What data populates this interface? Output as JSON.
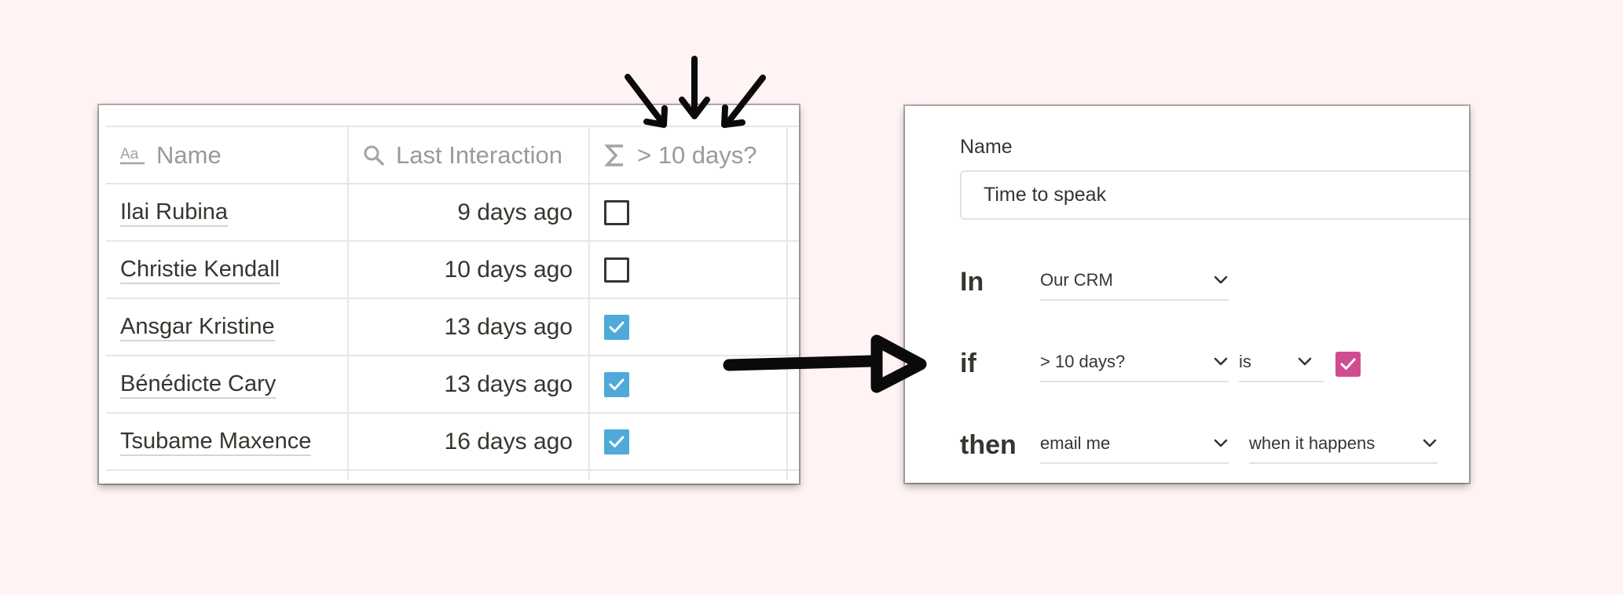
{
  "table": {
    "columns": [
      {
        "label": "Name",
        "icon": "text-property-icon"
      },
      {
        "label": "Last Interaction",
        "icon": "search-icon"
      },
      {
        "label": "> 10 days?",
        "icon": "sigma-icon"
      }
    ],
    "rows": [
      {
        "name": "Ilai Rubina",
        "last_interaction": "9 days ago",
        "over_10_days": false
      },
      {
        "name": "Christie Kendall",
        "last_interaction": "10 days ago",
        "over_10_days": false
      },
      {
        "name": "Ansgar Kristine",
        "last_interaction": "13 days ago",
        "over_10_days": true
      },
      {
        "name": "Bénédicte Cary",
        "last_interaction": "13 days ago",
        "over_10_days": true
      },
      {
        "name": "Tsubame Maxence",
        "last_interaction": "16 days ago",
        "over_10_days": true
      }
    ],
    "checkbox_checked_color": "#4fa9d9"
  },
  "rule": {
    "name_label": "Name",
    "name_value": "Time to speak",
    "in_keyword": "In",
    "in_database": "Our CRM",
    "if_keyword": "if",
    "if_property": "> 10 days?",
    "if_operator": "is",
    "if_value_checked": true,
    "if_value_color": "#d14b92",
    "then_keyword": "then",
    "then_action": "email me",
    "then_timing": "when it happens"
  },
  "background_color": "#fff3f4"
}
